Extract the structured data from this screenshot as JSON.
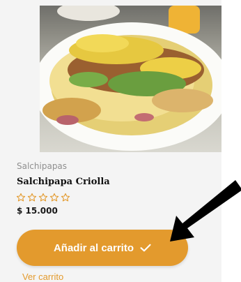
{
  "product": {
    "image_icon": "food-photo-salchipapa",
    "category": "Salchipapas",
    "title": "Salchipapa Criolla",
    "rating": 0,
    "rating_max": 5,
    "price": "$ 15.000"
  },
  "actions": {
    "add_to_cart_label": "Añadir al carrito",
    "add_to_cart_icon": "check-icon",
    "view_cart_label": "Ver carrito"
  },
  "colors": {
    "accent": "#e39a2d",
    "title": "#111111",
    "muted": "#8f8f8f",
    "annotation_arrow": "#000000"
  }
}
